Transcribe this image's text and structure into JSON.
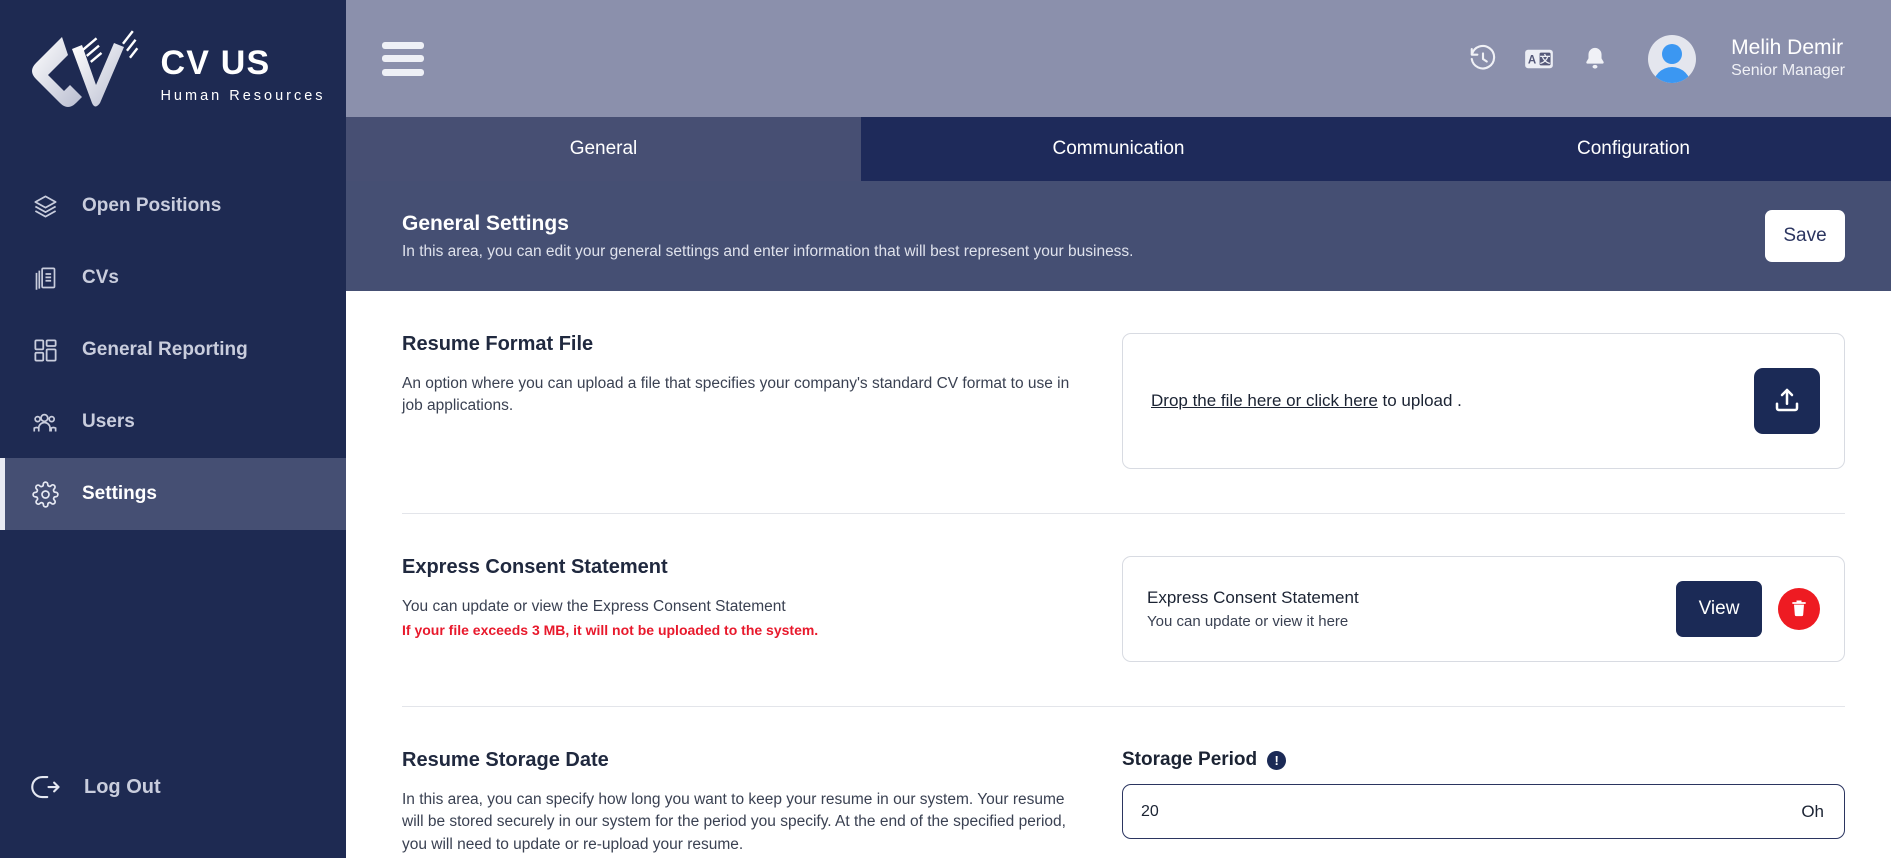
{
  "brand": {
    "title": "CV US",
    "subtitle": "Human Resources",
    "logo_icon": "cv-us-logo"
  },
  "sidebar": {
    "items": [
      {
        "label": "Open Positions",
        "icon": "layers-icon",
        "active": false
      },
      {
        "label": "CVs",
        "icon": "documents-icon",
        "active": false
      },
      {
        "label": "General Reporting",
        "icon": "dashboard-grid-icon",
        "active": false
      },
      {
        "label": "Users",
        "icon": "users-group-icon",
        "active": false
      },
      {
        "label": "Settings",
        "icon": "gear-icon",
        "active": true
      }
    ],
    "logout": {
      "label": "Log Out",
      "icon": "logout-icon"
    }
  },
  "topbar": {
    "menu_icon": "hamburger-icon",
    "icons": [
      {
        "name": "history-icon"
      },
      {
        "name": "translate-icon"
      },
      {
        "name": "bell-icon"
      }
    ],
    "user": {
      "name": "Melih Demir",
      "role": "Senior Manager",
      "avatar_icon": "avatar-icon"
    }
  },
  "tabs": [
    {
      "label": "General",
      "active": true
    },
    {
      "label": "Communication",
      "active": false
    },
    {
      "label": "Configuration",
      "active": false
    }
  ],
  "page_header": {
    "title": "General Settings",
    "subtitle": "In this area, you can edit your general settings and enter information that will best represent your business.",
    "save_label": "Save"
  },
  "sections": {
    "resume_format": {
      "title": "Resume Format File",
      "description": "An option where you can upload a file that specifies your company's standard CV format to use in job applications.",
      "dropzone_link": "Drop the file here or click here",
      "dropzone_rest": " to upload .",
      "upload_icon": "upload-icon"
    },
    "express_consent": {
      "title": "Express Consent Statement",
      "description": "You can update or view the Express Consent Statement",
      "warning": "If your file exceeds 3 MB, it will not be uploaded to the system.",
      "card_title": "Express Consent Statement",
      "card_subtitle": "You can update or view it here",
      "view_label": "View",
      "delete_icon": "trash-icon"
    },
    "resume_storage": {
      "title": "Resume Storage Date",
      "description": "In this area, you can specify how long you want to keep your resume in our system. Your resume will be stored securely in our system for the period you specify. At the end of the specified period, you will need to update or re-upload your resume.",
      "field_label": "Storage Period",
      "info_icon": "info-icon",
      "info_glyph": "!",
      "field_value": "20",
      "field_placeholder": "20",
      "field_suffix": "Oh"
    }
  },
  "colors": {
    "sidebar_bg": "#1e2a52",
    "topbar_bg": "#8b90ac",
    "tab_bg": "#1e2a5a",
    "tab_active_bg": "#474f73",
    "page_head_bg": "#454f73",
    "accent_navy": "#1b2a56",
    "danger_red": "#ee1b22",
    "warning_text": "#e8192c",
    "avatar_blue": "#3b97f2"
  }
}
